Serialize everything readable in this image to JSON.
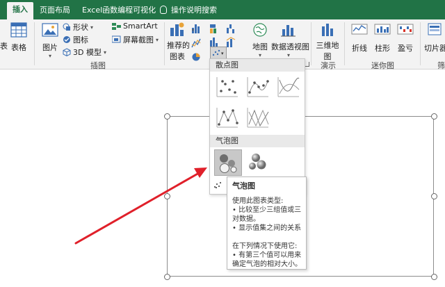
{
  "tabs": [
    {
      "label": "插入",
      "active": true
    },
    {
      "label": "页面布局"
    },
    {
      "label": "Excel函数编程可视化"
    },
    {
      "label": "操作说明搜索"
    }
  ],
  "ribbon": {
    "left_cut": "表",
    "table": "表格",
    "pictures": "图片",
    "shapes": "形状",
    "icons": "图标",
    "models3d": "3D 模型",
    "smartart": "SmartArt",
    "screenshot": "屏幕截图",
    "illustrations_group": "插图",
    "recommended_charts_line1": "推荐的",
    "recommended_charts_line2": "图表",
    "map": "地图",
    "pivotchart": "数据透视图",
    "map3d_line1": "三维地",
    "map3d_line2": "图",
    "tours_group": "演示",
    "spark_line": "折线",
    "spark_column": "柱形",
    "spark_winloss": "盈亏",
    "sparklines_group": "迷你图",
    "slicer": "切片器",
    "filter_cut": "筛"
  },
  "dropdown": {
    "scatter_header": "散点图",
    "bubble_header": "气泡图"
  },
  "tooltip": {
    "title": "气泡图",
    "line1": "使用此图表类型:",
    "line2": "• 比较至少三组值或三",
    "line3": "对数据。",
    "line4": "• 显示值集之间的关系",
    "line5": "在下列情况下使用它:",
    "line6": "• 有第三个值可以用来",
    "line7": "确定气泡的相对大小。"
  },
  "colors": {
    "excel_green": "#217346",
    "arrow_red": "#e0202a",
    "ribbon_bg": "#f3f3f3"
  }
}
